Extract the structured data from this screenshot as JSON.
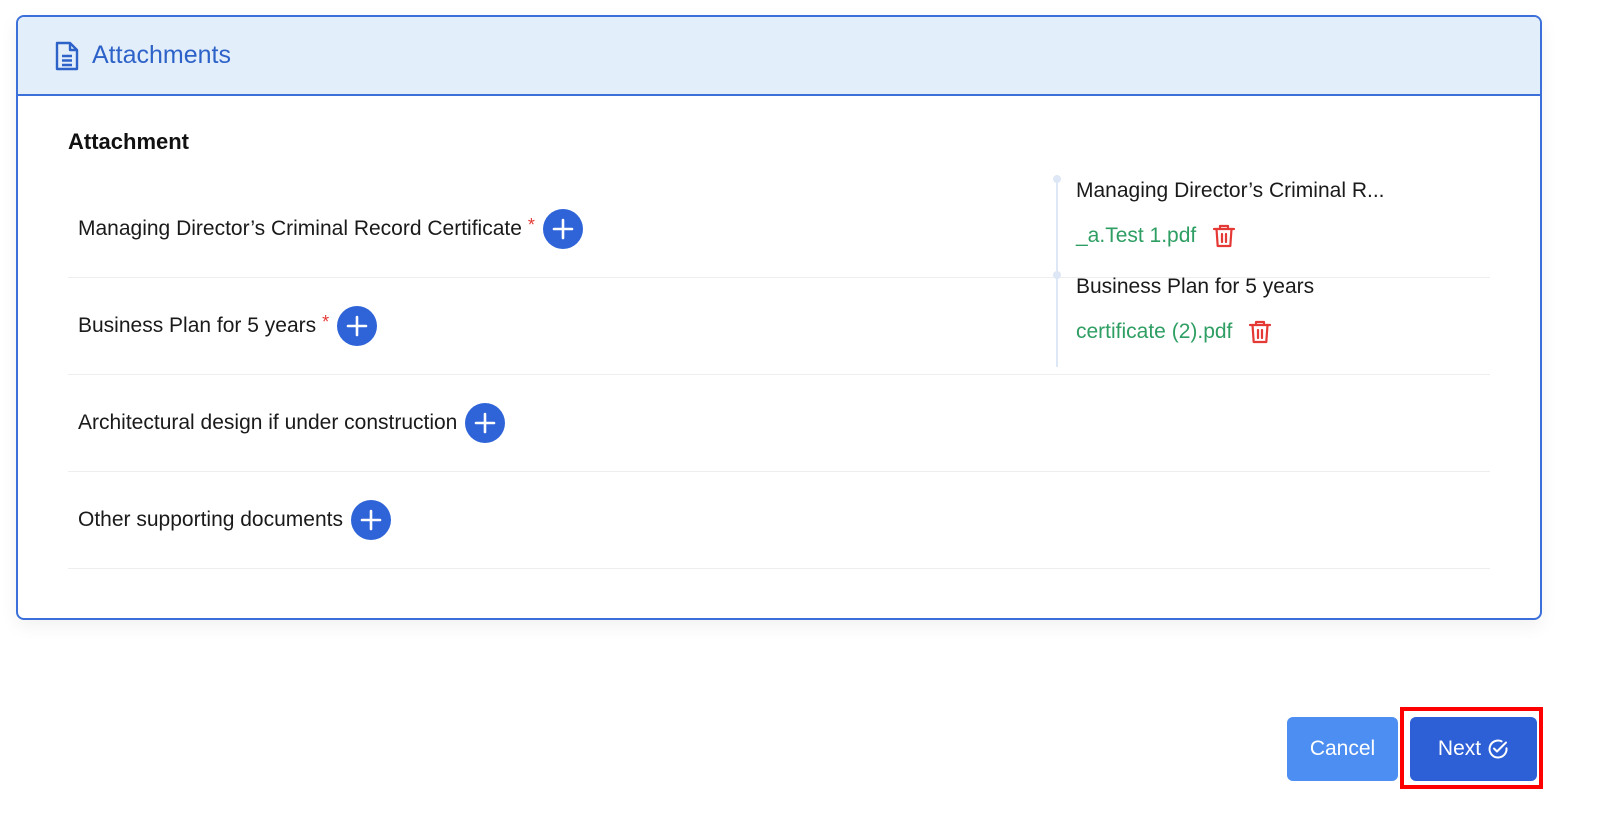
{
  "card": {
    "header_title": "Attachments",
    "header_icon": "document-icon",
    "section_title": "Attachment"
  },
  "rows": [
    {
      "label": "Managing Director’s Criminal Record Certificate",
      "required": true,
      "required_mark": "*"
    },
    {
      "label": "Business Plan for 5 years",
      "required": true,
      "required_mark": "*"
    },
    {
      "label": "Architectural design if under construction",
      "required": false
    },
    {
      "label": "Other supporting documents",
      "required": false
    }
  ],
  "uploaded_files": [
    {
      "title": "Managing Director’s Criminal R...",
      "file_name": "_a.Test 1.pdf"
    },
    {
      "title": "Business Plan for 5 years",
      "file_name": "certificate (2).pdf"
    }
  ],
  "actions": {
    "cancel_label": "Cancel",
    "next_label": "Next"
  },
  "colors": {
    "accent": "#2f63d8",
    "header_bg": "#e3eefb",
    "file_link": "#2e9e63",
    "delete": "#e53935",
    "highlight": "#ff0000"
  }
}
